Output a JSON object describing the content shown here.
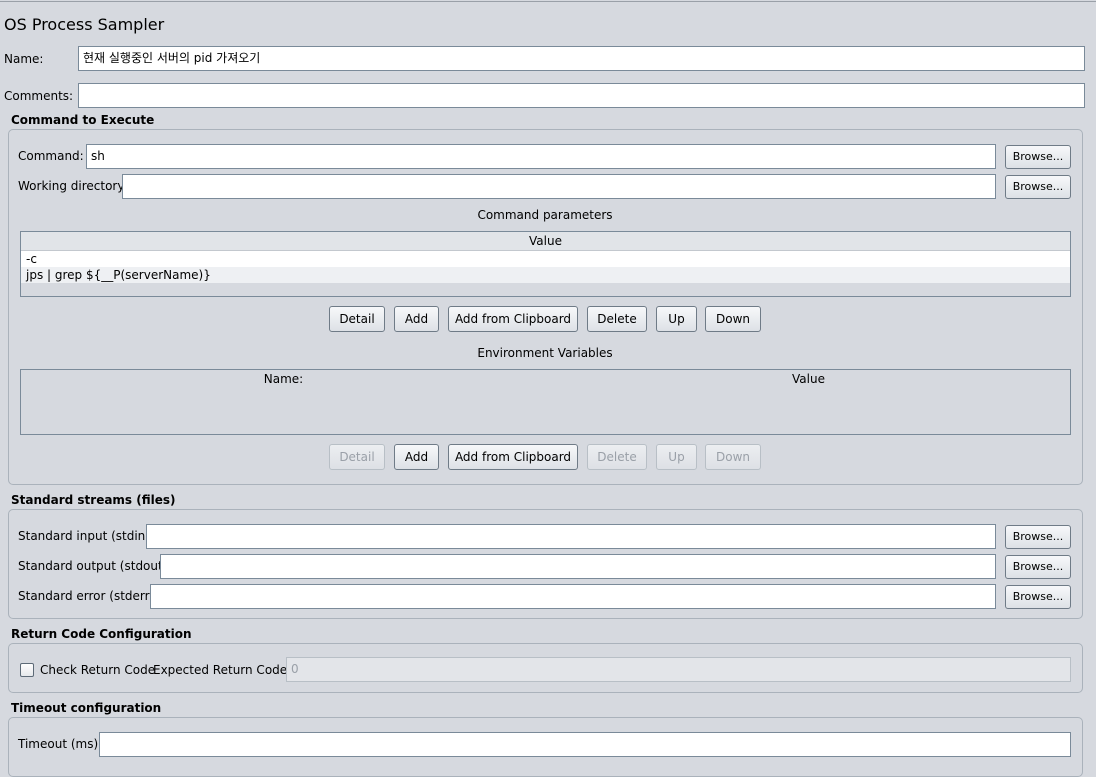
{
  "window": {
    "title": "OS Process Sampler"
  },
  "name_field": {
    "label": "Name:",
    "value": "현재 실행중인 서버의 pid 가져오기"
  },
  "comments_field": {
    "label": "Comments:",
    "value": ""
  },
  "command_section": {
    "title": "Command to Execute",
    "command_label": "Command:",
    "command_value": "sh",
    "workdir_label": "Working directory:",
    "workdir_value": "",
    "browse_label": "Browse...",
    "params_title": "Command parameters",
    "params_header": "Value",
    "params_rows": [
      "-c",
      "jps | grep ${__P(serverName)}"
    ],
    "env_title": "Environment Variables",
    "env_headers": [
      "Name:",
      "Value"
    ],
    "buttons": {
      "detail": "Detail",
      "add": "Add",
      "add_clipboard": "Add from Clipboard",
      "delete": "Delete",
      "up": "Up",
      "down": "Down"
    }
  },
  "streams_section": {
    "title": "Standard streams (files)",
    "stdin_label": "Standard input (stdin):",
    "stdout_label": "Standard output (stdout):",
    "stderr_label": "Standard error (stderr):",
    "browse_label": "Browse..."
  },
  "return_section": {
    "title": "Return Code Configuration",
    "check_label": "Check Return Code",
    "checked": false,
    "expected_label": "Expected Return Code:",
    "expected_value": "0"
  },
  "timeout_section": {
    "title": "Timeout configuration",
    "timeout_label": "Timeout (ms)",
    "timeout_value": ""
  }
}
